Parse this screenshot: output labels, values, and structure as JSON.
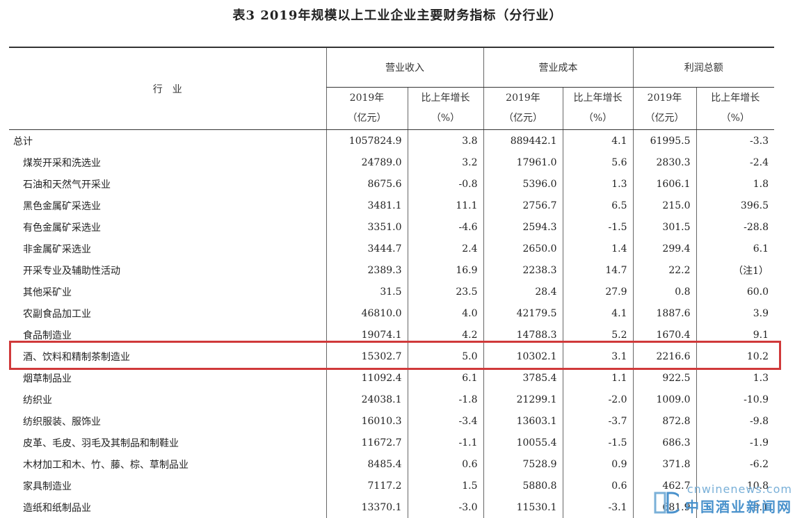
{
  "title": "表3  2019年规模以上工业企业主要财务指标（分行业）",
  "header": {
    "industry": "行　业",
    "groups": [
      "营业收入",
      "营业成本",
      "利润总额"
    ],
    "sub_year": "2019年",
    "sub_year_unit": "（亿元）",
    "sub_growth": "比上年增长",
    "sub_growth_unit": "（%）"
  },
  "rows": [
    {
      "name": "总计",
      "indent": false,
      "v": [
        "1057824.9",
        "3.8",
        "889442.1",
        "4.1",
        "61995.5",
        "-3.3"
      ]
    },
    {
      "name": "煤炭开采和洗选业",
      "indent": true,
      "v": [
        "24789.0",
        "3.2",
        "17961.0",
        "5.6",
        "2830.3",
        "-2.4"
      ]
    },
    {
      "name": "石油和天然气开采业",
      "indent": true,
      "v": [
        "8675.6",
        "-0.8",
        "5396.0",
        "1.3",
        "1606.1",
        "1.8"
      ]
    },
    {
      "name": "黑色金属矿采选业",
      "indent": true,
      "v": [
        "3481.1",
        "11.1",
        "2756.7",
        "6.5",
        "215.0",
        "396.5"
      ]
    },
    {
      "name": "有色金属矿采选业",
      "indent": true,
      "v": [
        "3351.0",
        "-4.6",
        "2594.3",
        "-1.5",
        "301.5",
        "-28.8"
      ]
    },
    {
      "name": "非金属矿采选业",
      "indent": true,
      "v": [
        "3444.7",
        "2.4",
        "2650.0",
        "1.4",
        "299.4",
        "6.1"
      ]
    },
    {
      "name": "开采专业及辅助性活动",
      "indent": true,
      "v": [
        "2389.3",
        "16.9",
        "2238.3",
        "14.7",
        "22.2",
        "（注1）"
      ]
    },
    {
      "name": "其他采矿业",
      "indent": true,
      "v": [
        "31.5",
        "23.5",
        "28.4",
        "27.9",
        "0.8",
        "60.0"
      ]
    },
    {
      "name": "农副食品加工业",
      "indent": true,
      "v": [
        "46810.0",
        "4.0",
        "42179.5",
        "4.1",
        "1887.6",
        "3.9"
      ]
    },
    {
      "name": "食品制造业",
      "indent": true,
      "v": [
        "19074.1",
        "4.2",
        "14788.3",
        "5.2",
        "1670.4",
        "9.1"
      ]
    },
    {
      "name": "酒、饮料和精制茶制造业",
      "indent": true,
      "v": [
        "15302.7",
        "5.0",
        "10302.1",
        "3.1",
        "2216.6",
        "10.2"
      ]
    },
    {
      "name": "烟草制品业",
      "indent": true,
      "v": [
        "11092.4",
        "6.1",
        "3785.4",
        "1.1",
        "922.5",
        "1.3"
      ]
    },
    {
      "name": "纺织业",
      "indent": true,
      "v": [
        "24038.1",
        "-1.8",
        "21299.1",
        "-2.0",
        "1009.0",
        "-10.9"
      ]
    },
    {
      "name": "纺织服装、服饰业",
      "indent": true,
      "v": [
        "16010.3",
        "-3.4",
        "13603.1",
        "-3.7",
        "872.8",
        "-9.8"
      ]
    },
    {
      "name": "皮革、毛皮、羽毛及其制品和制鞋业",
      "indent": true,
      "v": [
        "11672.7",
        "-1.1",
        "10055.4",
        "-1.5",
        "686.3",
        "-1.9"
      ]
    },
    {
      "name": "木材加工和木、竹、藤、棕、草制品业",
      "indent": true,
      "v": [
        "8485.4",
        "0.6",
        "7528.9",
        "0.9",
        "371.8",
        "-6.2"
      ]
    },
    {
      "name": "家具制造业",
      "indent": true,
      "v": [
        "7117.2",
        "1.5",
        "5880.8",
        "0.6",
        "462.7",
        "10.8"
      ]
    },
    {
      "name": "造纸和纸制品业",
      "indent": true,
      "v": [
        "13370.1",
        "-3.0",
        "11530.1",
        "-3.1",
        "681.9",
        "-9.1"
      ]
    }
  ],
  "watermark": {
    "url": "cnwinenews.com",
    "cn": "中国酒业新闻网"
  },
  "colors": {
    "highlight": "#d0393a",
    "watermark": "#4a92cc"
  }
}
